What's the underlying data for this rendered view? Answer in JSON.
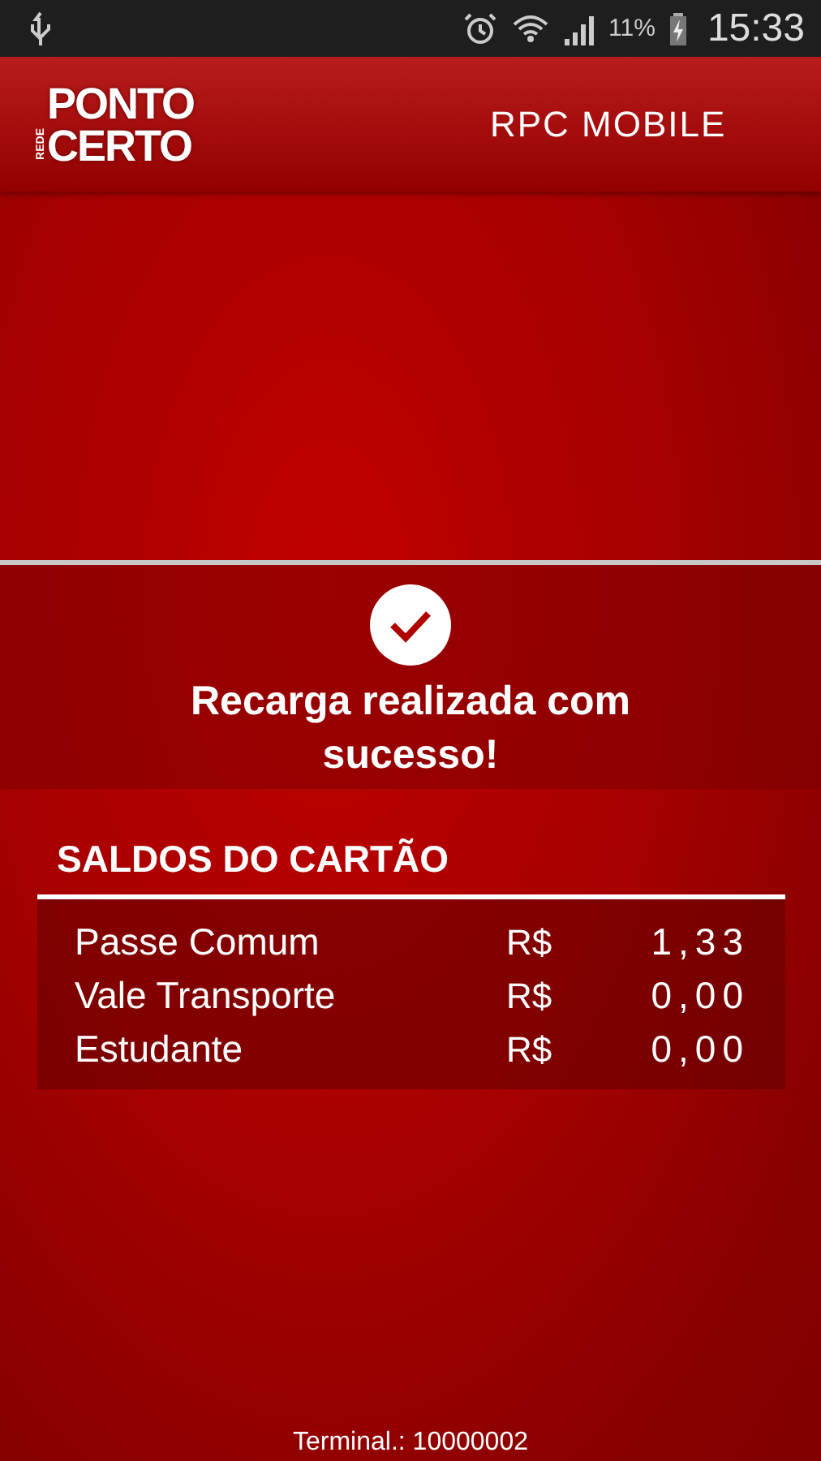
{
  "status_bar": {
    "battery_text": "11%",
    "time": "15:33"
  },
  "header": {
    "logo": {
      "small": "REDE",
      "top": "PONTO",
      "bottom": "CERTO"
    },
    "title": "RPC MOBILE"
  },
  "result": {
    "success": true,
    "message": "Recarga realizada com sucesso!"
  },
  "balances": {
    "title": "SALDOS DO CARTÃO",
    "rows": [
      {
        "name": "Passe Comum",
        "currency": "R$",
        "amount": "1,33"
      },
      {
        "name": "Vale Transporte",
        "currency": "R$",
        "amount": "0,00"
      },
      {
        "name": "Estudante",
        "currency": "R$",
        "amount": "0,00"
      }
    ]
  },
  "footer": {
    "terminal": "Terminal.: 10000002"
  }
}
